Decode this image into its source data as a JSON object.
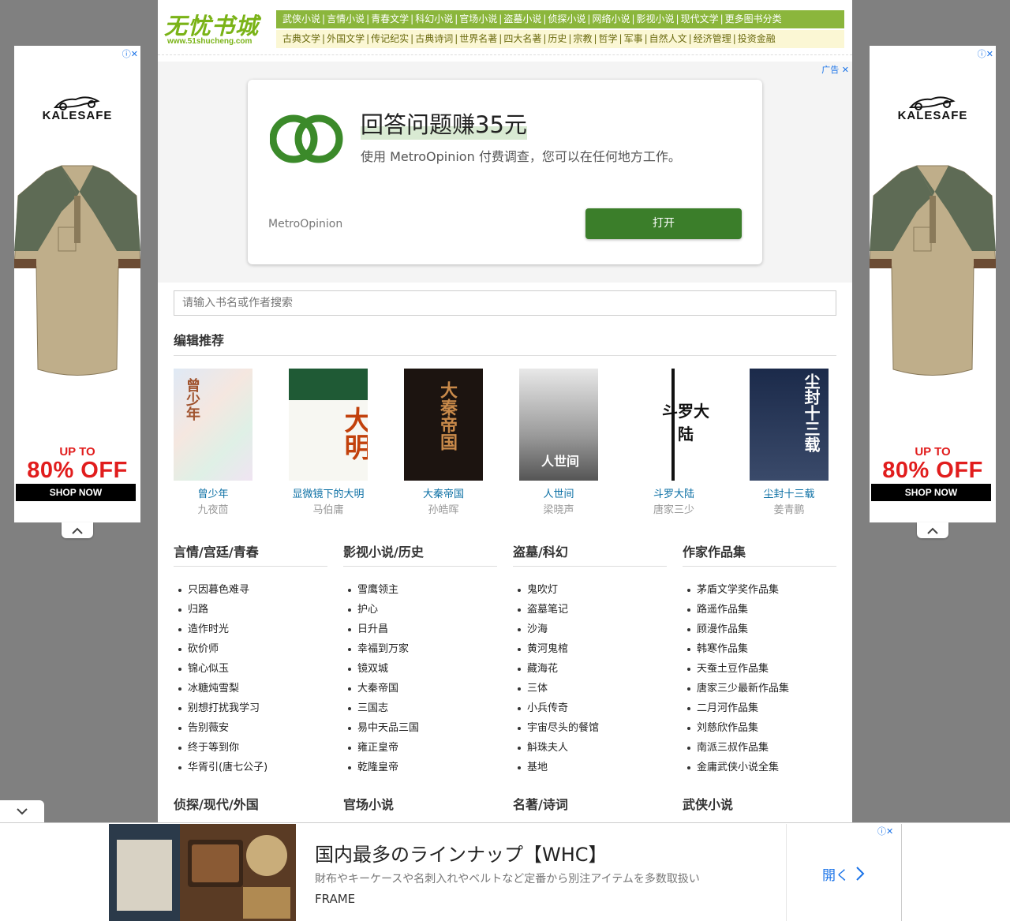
{
  "site": {
    "logo_cn": "无忧书城",
    "logo_url": "www.51shucheng.com"
  },
  "nav_primary": [
    "武侠小说",
    "言情小说",
    "青春文学",
    "科幻小说",
    "官场小说",
    "盗墓小说",
    "侦探小说",
    "网络小说",
    "影视小说",
    "现代文学",
    "更多图书分类"
  ],
  "nav_secondary": [
    "古典文学",
    "外国文学",
    "传记纪实",
    "古典诗词",
    "世界名著",
    "四大名著",
    "历史",
    "宗教",
    "哲学",
    "军事",
    "自然人文",
    "经济管理",
    "投资金融"
  ],
  "side_ad": {
    "brand": "KALESAFE",
    "upto": "UP TO",
    "discount": "80% OFF",
    "cta": "SHOP NOW"
  },
  "top_ad": {
    "label": "广告",
    "title": "回答问题赚35元",
    "description": "使用 MetroOpinion 付费调查，您可以在任何地方工作。",
    "brand": "MetroOpinion",
    "button": "打开"
  },
  "search": {
    "placeholder": "请输入书名或作者搜索"
  },
  "recommend": {
    "title": "编辑推荐",
    "books": [
      {
        "name": "曾少年",
        "author": "九夜茴"
      },
      {
        "name": "显微镜下的大明",
        "author": "马伯庸"
      },
      {
        "name": "大秦帝国",
        "author": "孙皓晖"
      },
      {
        "name": "人世间",
        "author": "梁晓声"
      },
      {
        "name": "斗罗大陆",
        "author": "唐家三少"
      },
      {
        "name": "尘封十三载",
        "author": "姜青鹏"
      }
    ]
  },
  "categories": [
    {
      "title": "言情/宫廷/青春",
      "items": [
        "只因暮色难寻",
        "归路",
        "造作时光",
        "砍价师",
        "锦心似玉",
        "冰糖炖雪梨",
        "别想打扰我学习",
        "告别薇安",
        "终于等到你",
        "华胥引(唐七公子)"
      ]
    },
    {
      "title": "影视小说/历史",
      "items": [
        "雪鹰领主",
        "护心",
        "日升昌",
        "幸福到万家",
        "镜双城",
        "大秦帝国",
        "三国志",
        "易中天品三国",
        "雍正皇帝",
        "乾隆皇帝"
      ]
    },
    {
      "title": "盗墓/科幻",
      "items": [
        "鬼吹灯",
        "盗墓笔记",
        "沙海",
        "黄河鬼棺",
        "藏海花",
        "三体",
        "小兵传奇",
        "宇宙尽头的餐馆",
        "斛珠夫人",
        "基地"
      ]
    },
    {
      "title": "作家作品集",
      "items": [
        "茅盾文学奖作品集",
        "路遥作品集",
        "顾漫作品集",
        "韩寒作品集",
        "天蚕土豆作品集",
        "唐家三少最新作品集",
        "二月河作品集",
        "刘慈欣作品集",
        "南派三叔作品集",
        "金庸武侠小说全集"
      ]
    }
  ],
  "categories_row2": [
    "侦探/现代/外国",
    "官场小说",
    "名著/诗词",
    "武侠小说"
  ],
  "bottom_ad": {
    "title": "国内最多のラインナップ【WHC】",
    "description": "財布やキーケースや名刺入れやベルトなど定番から別注アイテムを多数取扱い",
    "brand": "FRAME",
    "open": "開く"
  },
  "colors": {
    "nav_green": "#8bb63c",
    "nav_cream": "#fbf7d4",
    "link_blue": "#0b6fa4",
    "ad_button": "#3b7e2a"
  }
}
